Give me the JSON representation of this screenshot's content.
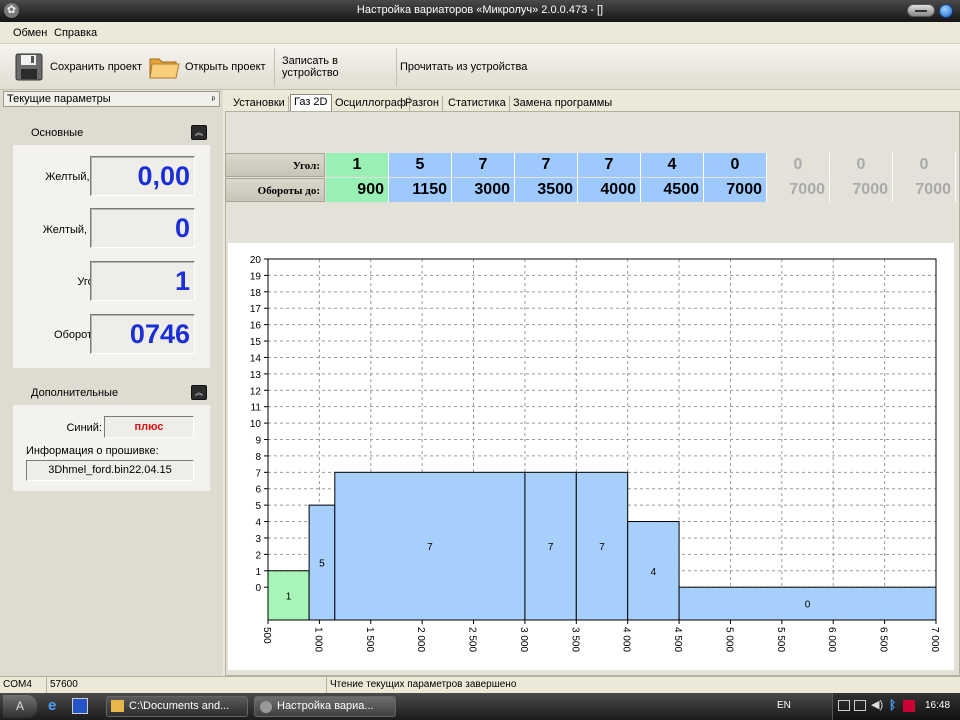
{
  "window": {
    "title": "Настройка вариаторов «Микролуч» 2.0.0.473 - []"
  },
  "menu": [
    "Обмен",
    "Справка"
  ],
  "toolbar": {
    "save_label": "Сохранить проект",
    "open_label": "Открыть проект",
    "write_label": "Записать в устройство",
    "read_label": "Прочитать из устройства"
  },
  "left_panel": {
    "title": "Текущие параметры",
    "pin_glyph": "ᵖ",
    "main_group": {
      "title": "Основные",
      "rows": [
        {
          "label": "Желтый, В:",
          "value": "0,00"
        },
        {
          "label": "Желтый, %:",
          "value": "0"
        },
        {
          "label": "Угол:",
          "value": "1"
        },
        {
          "label": "Обороты:",
          "value": "0746"
        }
      ]
    },
    "extra_group": {
      "title": "Дополнительные",
      "blue_label": "Синий:",
      "blue_value": "плюс",
      "firmware_label": "Информация о прошивке:",
      "firmware_value": "3Dhmel_ford.bin22.04.15"
    }
  },
  "tabs": [
    "Установки",
    "Газ 2D",
    "Осциллограф",
    "Разгон",
    "Статистика",
    "Замена программы"
  ],
  "active_tab": 1,
  "grid": {
    "angle_label": "Угол:",
    "rpm_label": "Обороты до:",
    "angles": [
      "1",
      "5",
      "7",
      "7",
      "7",
      "4",
      "0",
      "0",
      "0",
      "0"
    ],
    "rpms": [
      "900",
      "1150",
      "3000",
      "3500",
      "4000",
      "4500",
      "7000",
      "7000",
      "7000",
      "7000"
    ],
    "active_count": 7,
    "colors": {
      "first": "#98f0b4",
      "active": "#9ec9ff",
      "inactive_text": "#aaaaaa"
    }
  },
  "chart_data": {
    "type": "bar",
    "title": "",
    "xlabel": "",
    "ylabel": "",
    "xlim": [
      500,
      7000
    ],
    "ylim": [
      -2,
      20
    ],
    "x_ticks": [
      "500",
      "1 000",
      "1 500",
      "2 000",
      "2 500",
      "3 000",
      "3 500",
      "4 000",
      "4 500",
      "5 000",
      "5 500",
      "6 000",
      "6 500",
      "7 000"
    ],
    "x_tick_values": [
      500,
      1000,
      1500,
      2000,
      2500,
      3000,
      3500,
      4000,
      4500,
      5000,
      5500,
      6000,
      6500,
      7000
    ],
    "y_ticks": [
      0,
      1,
      2,
      3,
      4,
      5,
      6,
      7,
      8,
      9,
      10,
      11,
      12,
      13,
      14,
      15,
      16,
      17,
      18,
      19,
      20
    ],
    "grid": true,
    "steps": [
      {
        "from": 500,
        "to": 900,
        "value": 1,
        "label": "1",
        "color": "#a8f5b8"
      },
      {
        "from": 900,
        "to": 1150,
        "value": 5,
        "label": "5",
        "color": "#a6cffb"
      },
      {
        "from": 1150,
        "to": 3000,
        "value": 7,
        "label": "7",
        "color": "#a6cffb"
      },
      {
        "from": 3000,
        "to": 3500,
        "value": 7,
        "label": "7",
        "color": "#a6cffb"
      },
      {
        "from": 3500,
        "to": 4000,
        "value": 7,
        "label": "7",
        "color": "#a6cffb"
      },
      {
        "from": 4000,
        "to": 4500,
        "value": 4,
        "label": "4",
        "color": "#a6cffb"
      },
      {
        "from": 4500,
        "to": 7000,
        "value": 0,
        "label": "0",
        "color": "#a6cffb"
      }
    ]
  },
  "status": {
    "port": "COM4",
    "baud": "57600",
    "message": "Чтение текущих параметров завершено"
  },
  "taskbar": {
    "start_glyph": "A",
    "task1": "C:\\Documents and...",
    "task2": "Настройка вариа...",
    "lang": "EN",
    "clock": "16:48"
  }
}
